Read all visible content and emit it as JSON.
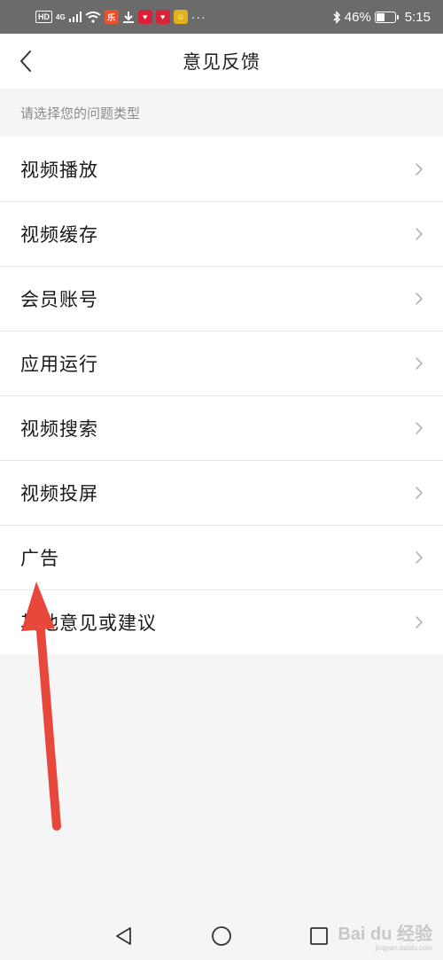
{
  "status_bar": {
    "hd": "HD",
    "network": "4G",
    "app_icons": [
      {
        "icon": "red-app-icon",
        "color": "#e8512c",
        "glyph": "乐"
      },
      {
        "icon": "download-icon"
      },
      {
        "icon": "heart-app-icon",
        "color": "#d8223a",
        "glyph": "♥"
      },
      {
        "icon": "heart-app-icon",
        "color": "#d8223a",
        "glyph": "♥"
      },
      {
        "icon": "yellow-app-icon",
        "color": "#e0b31a",
        "glyph": "☺"
      }
    ],
    "more": "···",
    "battery_percent": "46%",
    "battery_level": 0.46,
    "time": "5:15"
  },
  "header": {
    "title": "意见反馈"
  },
  "section": {
    "label": "请选择您的问题类型"
  },
  "items": [
    {
      "label": "视频播放"
    },
    {
      "label": "视频缓存"
    },
    {
      "label": "会员账号"
    },
    {
      "label": "应用运行"
    },
    {
      "label": "视频搜索"
    },
    {
      "label": "视频投屏"
    },
    {
      "label": "广告"
    },
    {
      "label": "其他意见或建议"
    }
  ],
  "watermark": {
    "main": "Bai du 经验",
    "sub": "jingyan.baidu.com"
  },
  "colors": {
    "annotation_arrow": "#e8473c",
    "status_bar_bg": "#6b6b6b",
    "chevron": "#b5b5b5"
  }
}
